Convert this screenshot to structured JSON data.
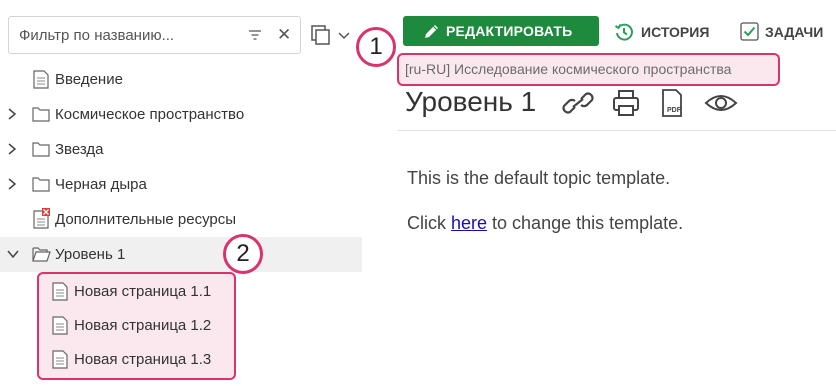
{
  "filter": {
    "placeholder": "Фильтр по названию...",
    "icon": "filter-lines-icon",
    "clear_icon": "close-icon",
    "clear_glyph": "✕"
  },
  "toolbar": {
    "edit_label": "РЕДАКТИРОВАТЬ",
    "history_label": "ИСТОРИЯ",
    "tasks_label": "ЗАДАЧИ"
  },
  "markers": {
    "one": "1",
    "two": "2"
  },
  "breadcrumb": "[ru-RU] Исследование космического пространства",
  "tree": {
    "items": [
      {
        "label": "Введение",
        "icon": "page-icon"
      },
      {
        "label": "Космическое пространство",
        "icon": "folder-icon"
      },
      {
        "label": "Звезда",
        "icon": "folder-icon"
      },
      {
        "label": "Черная дыра",
        "icon": "folder-icon"
      },
      {
        "label": "Дополнительные ресурсы",
        "icon": "page-error-icon"
      },
      {
        "label": "Уровень 1",
        "icon": "folder-open-icon"
      }
    ],
    "subitems": [
      {
        "label": "Новая страница 1.1",
        "icon": "page-icon"
      },
      {
        "label": "Новая страница 1.2",
        "icon": "page-icon"
      },
      {
        "label": "Новая страница 1.3",
        "icon": "page-icon"
      }
    ]
  },
  "page": {
    "title": "Уровень 1",
    "title_icons": [
      "link-icon",
      "print-icon",
      "pdf-icon",
      "eye-icon"
    ],
    "pdf_label": "PDF",
    "line1": "This is the default topic template.",
    "line2_pre": "Click ",
    "line2_link": "here",
    "line2_post": " to change this template."
  },
  "colors": {
    "accent": "#d9336e",
    "edit_button": "#1e8a3e",
    "history_icon": "#2e9e5b",
    "tasks_icon": "#2e9e5b"
  }
}
